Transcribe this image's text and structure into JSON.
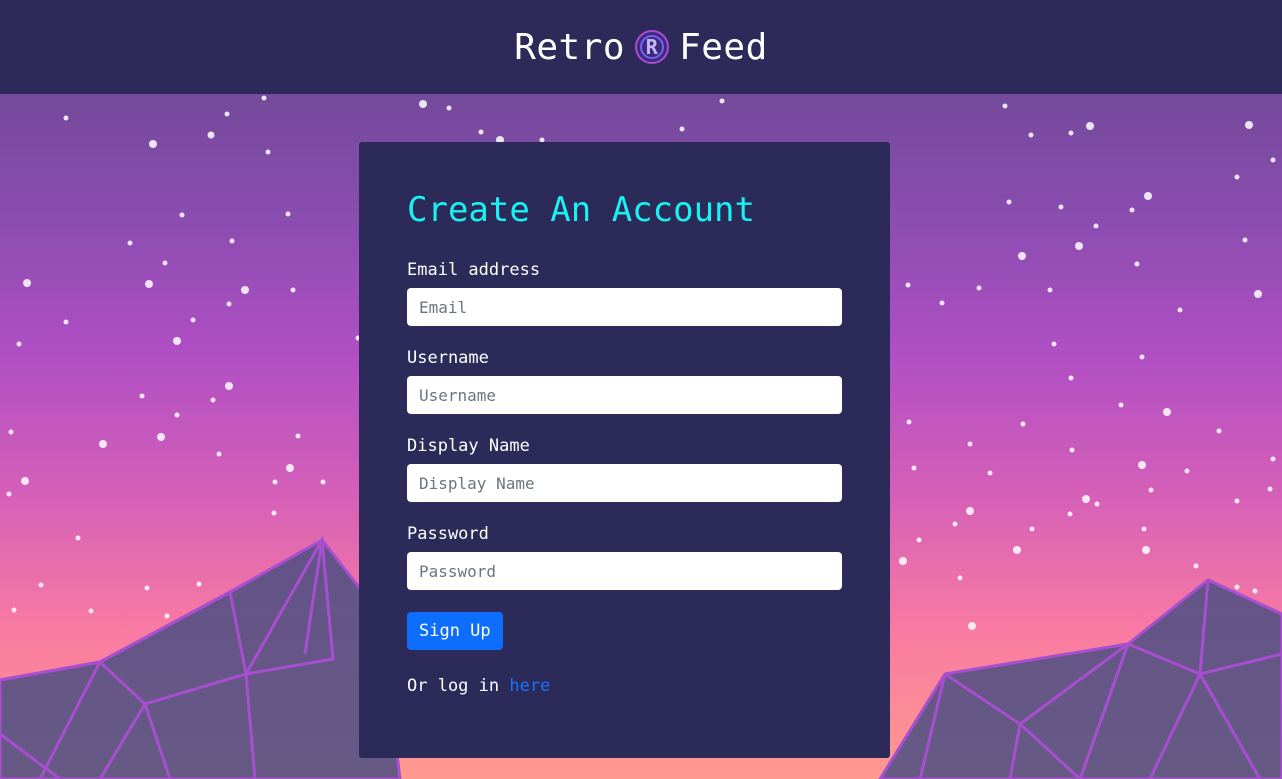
{
  "header": {
    "brand_left": "Retro",
    "logo_letter": "R",
    "brand_right": "Feed"
  },
  "form": {
    "title": "Create An Account",
    "fields": [
      {
        "label": "Email address",
        "placeholder": "Email",
        "value": ""
      },
      {
        "label": "Username",
        "placeholder": "Username",
        "value": ""
      },
      {
        "label": "Display Name",
        "placeholder": "Display Name",
        "value": ""
      },
      {
        "label": "Password",
        "placeholder": "Password",
        "value": ""
      }
    ],
    "submit_label": "Sign Up",
    "login_prefix": "Or log in ",
    "login_link": "here"
  },
  "colors": {
    "header_bg": "#2d2a5a",
    "card_bg": "#2c2a58",
    "title": "#19f2f2",
    "button": "#0d6efd",
    "link": "#1a73ff",
    "sky_top": "#744a9b",
    "sky_bottom": "#ff9a8f"
  },
  "icons": {
    "logo": "retro-r-logo-icon"
  }
}
